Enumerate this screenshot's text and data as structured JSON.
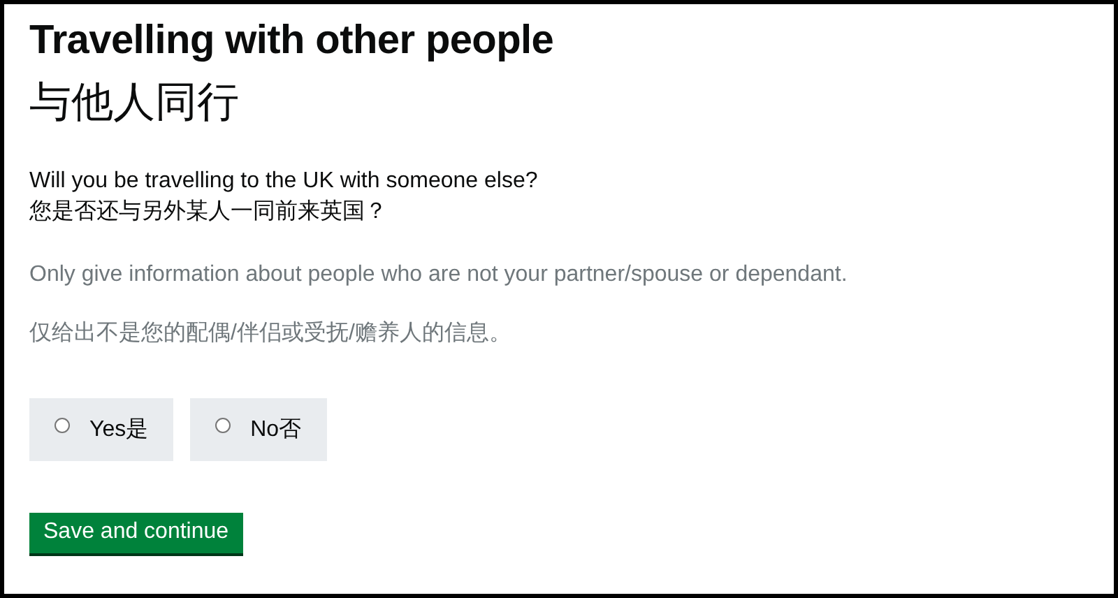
{
  "heading": "Travelling with other people",
  "heading_translation": "与他人同行",
  "question": "Will you be travelling to the UK with someone else?",
  "question_translation": "您是否还与另外某人一同前来英国？",
  "hint": "Only give information about people who are not your partner/spouse or dependant.",
  "hint_translation": "仅给出不是您的配偶/伴侣或受抚/赡养人的信息。",
  "options": [
    {
      "label": "Yes是",
      "selected": false
    },
    {
      "label": "No否",
      "selected": false
    }
  ],
  "button": "Save and continue"
}
